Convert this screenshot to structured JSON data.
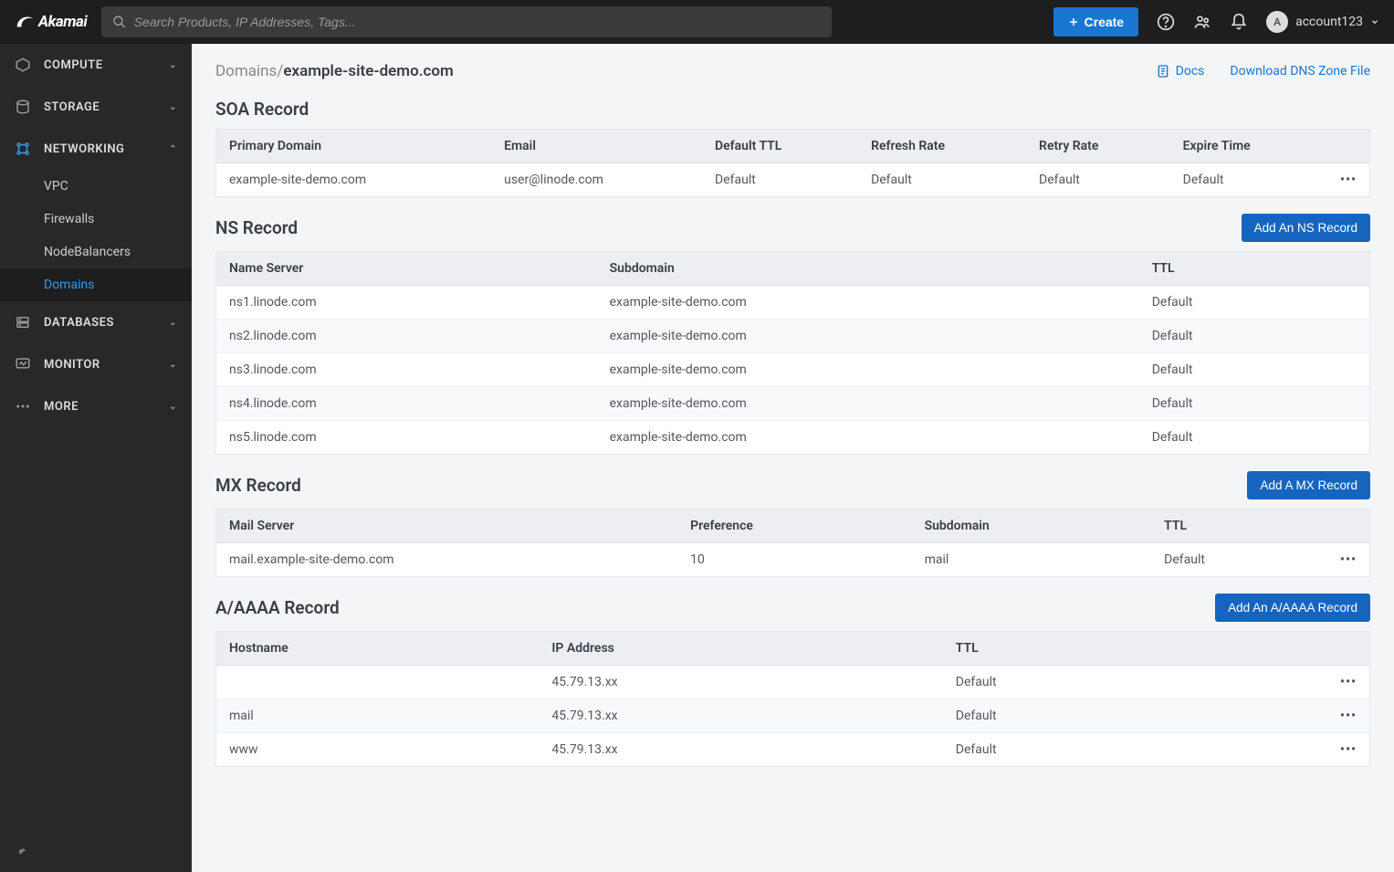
{
  "header": {
    "logo_text": "Akamai",
    "search_placeholder": "Search Products, IP Addresses, Tags...",
    "create_label": "Create",
    "account": {
      "initial": "A",
      "name": "account123"
    }
  },
  "sidebar": {
    "groups": [
      {
        "label": "COMPUTE",
        "expanded": false
      },
      {
        "label": "STORAGE",
        "expanded": false
      },
      {
        "label": "NETWORKING",
        "expanded": true,
        "items": [
          {
            "label": "VPC",
            "active": false
          },
          {
            "label": "Firewalls",
            "active": false
          },
          {
            "label": "NodeBalancers",
            "active": false
          },
          {
            "label": "Domains",
            "active": true
          }
        ]
      },
      {
        "label": "DATABASES",
        "expanded": false
      },
      {
        "label": "MONITOR",
        "expanded": false
      },
      {
        "label": "MORE",
        "expanded": false
      }
    ]
  },
  "breadcrumb": {
    "root": "Domains",
    "sep": "/",
    "current": "example-site-demo.com"
  },
  "links": {
    "docs": "Docs",
    "download": "Download DNS Zone File"
  },
  "sections": {
    "soa": {
      "title": "SOA Record",
      "cols": [
        "Primary Domain",
        "Email",
        "Default TTL",
        "Refresh Rate",
        "Retry Rate",
        "Expire Time"
      ],
      "rows": [
        {
          "c0": "example-site-demo.com",
          "c1": "user@linode.com",
          "c2": "Default",
          "c3": "Default",
          "c4": "Default",
          "c5": "Default"
        }
      ]
    },
    "ns": {
      "title": "NS Record",
      "add": "Add An NS Record",
      "cols": [
        "Name Server",
        "Subdomain",
        "TTL"
      ],
      "rows": [
        {
          "c0": "ns1.linode.com",
          "c1": "example-site-demo.com",
          "c2": "Default"
        },
        {
          "c0": "ns2.linode.com",
          "c1": "example-site-demo.com",
          "c2": "Default"
        },
        {
          "c0": "ns3.linode.com",
          "c1": "example-site-demo.com",
          "c2": "Default"
        },
        {
          "c0": "ns4.linode.com",
          "c1": "example-site-demo.com",
          "c2": "Default"
        },
        {
          "c0": "ns5.linode.com",
          "c1": "example-site-demo.com",
          "c2": "Default"
        }
      ]
    },
    "mx": {
      "title": "MX Record",
      "add": "Add A MX Record",
      "cols": [
        "Mail Server",
        "Preference",
        "Subdomain",
        "TTL"
      ],
      "rows": [
        {
          "c0": "mail.example-site-demo.com",
          "c1": "10",
          "c2": "mail",
          "c3": "Default"
        }
      ]
    },
    "a": {
      "title": "A/AAAA Record",
      "add": "Add An A/AAAA Record",
      "cols": [
        "Hostname",
        "IP Address",
        "TTL"
      ],
      "rows": [
        {
          "c0": "",
          "c1": "45.79.13.xx",
          "c2": "Default"
        },
        {
          "c0": "mail",
          "c1": "45.79.13.xx",
          "c2": "Default"
        },
        {
          "c0": "www",
          "c1": "45.79.13.xx",
          "c2": "Default"
        }
      ]
    }
  }
}
